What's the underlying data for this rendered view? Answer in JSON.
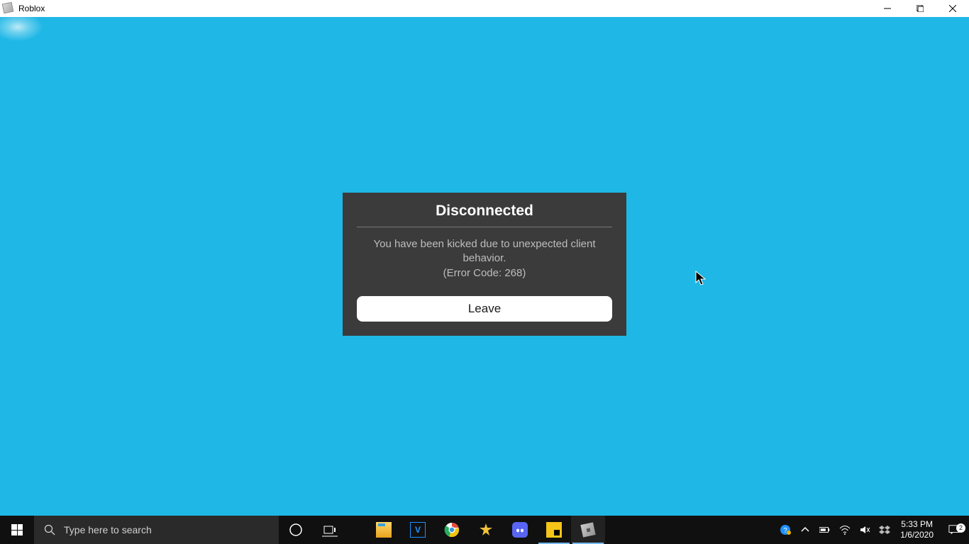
{
  "titlebar": {
    "title": "Roblox"
  },
  "dialog": {
    "title": "Disconnected",
    "message_line1": "You have been kicked due to unexpected client behavior.",
    "message_line2": "(Error Code: 268)",
    "button_label": "Leave"
  },
  "taskbar": {
    "search_placeholder": "Type here to search",
    "clock_time": "5:33 PM",
    "clock_date": "1/6/2020",
    "action_center_badge": "2",
    "pinned": [
      {
        "name": "cortana"
      },
      {
        "name": "task-view"
      },
      {
        "name": "file-explorer"
      },
      {
        "name": "visual-studio"
      },
      {
        "name": "chrome"
      },
      {
        "name": "star-app"
      },
      {
        "name": "discord"
      },
      {
        "name": "sticky-notes"
      },
      {
        "name": "roblox"
      }
    ]
  }
}
